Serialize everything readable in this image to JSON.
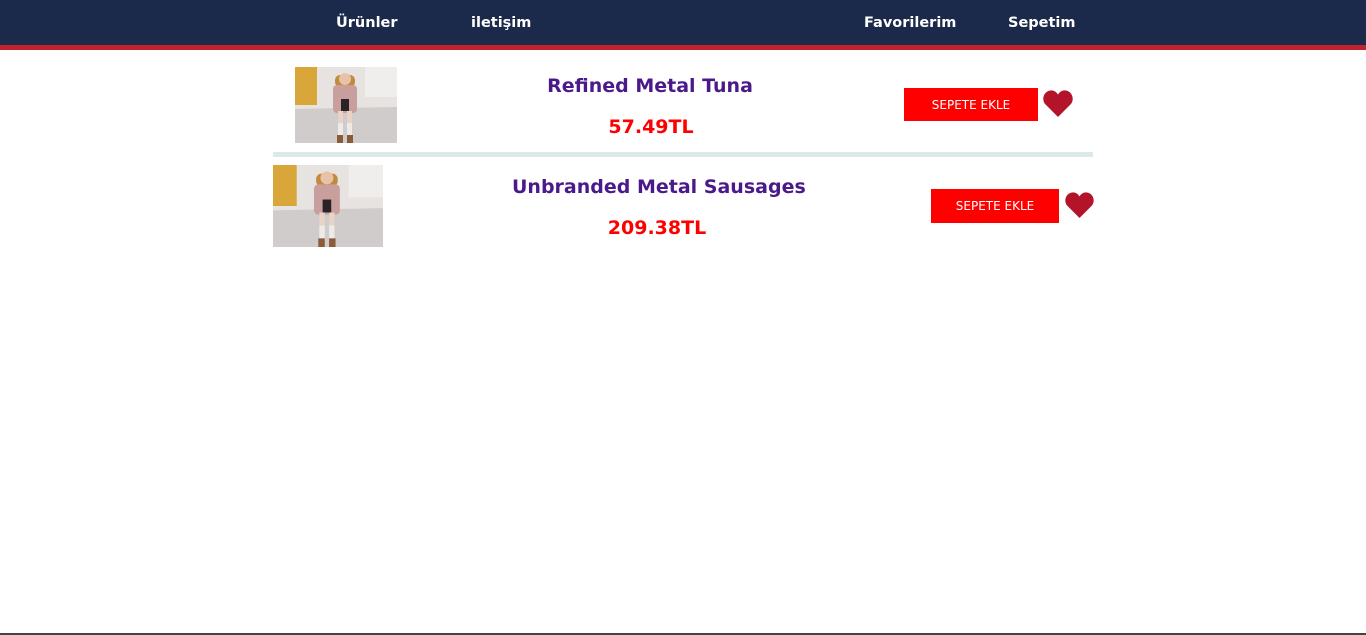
{
  "nav": {
    "products": "Ürünler",
    "contact": "iletişim",
    "favorites": "Favorilerim",
    "cart": "Sepetim"
  },
  "products": [
    {
      "name": "Refined Metal Tuna",
      "price": "57.49TL",
      "button_label": "SEPETE EKLE"
    },
    {
      "name": "Unbranded Metal Sausages",
      "price": "209.38TL",
      "button_label": "SEPETE EKLE"
    }
  ],
  "icons": {
    "favorite": "heart-icon"
  },
  "colors": {
    "navbar": "#1b2a4b",
    "navbar_accent": "#c0232b",
    "product_title": "#4b1a8a",
    "price": "#ff0000",
    "button": "#ff0000",
    "heart": "#b3142a"
  }
}
